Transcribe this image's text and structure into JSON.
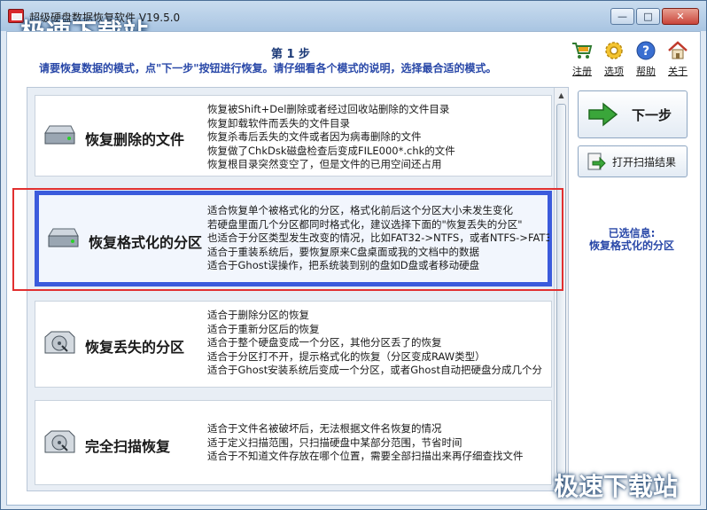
{
  "window": {
    "title": "超级硬盘数据恢复软件 V19.5.0",
    "minimize_label": "—",
    "maximize_label": "□",
    "close_label": "✕"
  },
  "watermark": {
    "top": "极速下载站",
    "bottom": "极速下载站"
  },
  "header": {
    "step_title": "第 1 步",
    "step_desc": "请要恢复数据的模式，点\"下一步\"按钮进行恢复。请仔细看各个模式的说明，选择最合适的模式。"
  },
  "toolbar": {
    "items": [
      {
        "label": "注册",
        "icon": "cart-icon"
      },
      {
        "label": "选项",
        "icon": "gear-icon"
      },
      {
        "label": "帮助",
        "icon": "help-icon"
      },
      {
        "label": "关于",
        "icon": "home-icon"
      }
    ]
  },
  "modes": [
    {
      "name": "恢复删除的文件",
      "icon": "drive-icon",
      "desc": [
        "恢复被Shift+Del删除或者经过回收站删除的文件目录",
        "恢复卸载软件而丢失的文件目录",
        "恢复杀毒后丢失的文件或者因为病毒删除的文件",
        "恢复做了ChkDsk磁盘检查后变成FILE000*.chk的文件",
        "恢复根目录突然变空了，但是文件的已用空间还占用"
      ]
    },
    {
      "name": "恢复格式化的分区",
      "icon": "drive-icon",
      "selected": true,
      "desc": [
        "适合恢复单个被格式化的分区，格式化前后这个分区大小未发生变化",
        "若硬盘里面几个分区都同时格式化，建议选择下面的\"恢复丢失的分区\"",
        "也适合于分区类型发生改变的情况，比如FAT32->NTFS，或者NTFS->FAT3",
        "适合于重装系统后，要恢复原来C盘桌面或我的文档中的数据",
        "适合于Ghost误操作，把系统装到别的盘如D盘或者移动硬盘"
      ]
    },
    {
      "name": "恢复丢失的分区",
      "icon": "disc-drive-icon",
      "desc": [
        "适合于删除分区的恢复",
        "适合于重新分区后的恢复",
        "适合于整个硬盘变成一个分区，其他分区丢了的恢复",
        "适合于分区打不开，提示格式化的恢复（分区变成RAW类型）",
        "适合于Ghost安装系统后变成一个分区，或者Ghost自动把硬盘分成几个分"
      ]
    },
    {
      "name": "完全扫描恢复",
      "icon": "disc-drive-icon",
      "desc": [
        "适合于文件名被破坏后，无法根据文件名恢复的情况",
        "适于定义扫描范围，只扫描硬盘中某部分范围，节省时间",
        "适合于不知道文件存放在哪个位置，需要全部扫描出来再仔细查找文件"
      ]
    }
  ],
  "actions": {
    "next_label": "下一步",
    "open_scan_label": "打开扫描结果"
  },
  "info": {
    "label": "已选信息:",
    "value": "恢复格式化的分区"
  },
  "colors": {
    "accent": "#2948a8",
    "selected_border": "#3b5bdc",
    "highlight": "#e13030"
  }
}
